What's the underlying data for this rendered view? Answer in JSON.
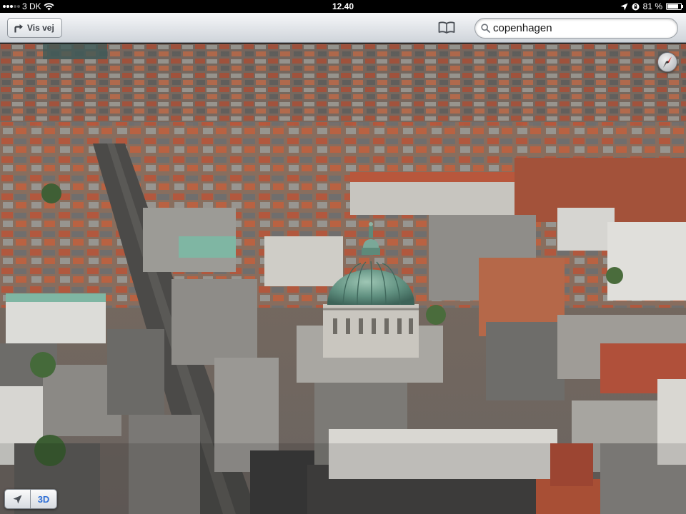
{
  "status_bar": {
    "carrier": "3 DK",
    "time": "12.40",
    "battery_percent": "81 %",
    "battery_level": 0.81
  },
  "toolbar": {
    "directions_label": "Vis vej",
    "directions_icon": "turn-right-arrow-icon",
    "bookmarks_icon": "open-book-icon",
    "search": {
      "value": "copenhagen"
    }
  },
  "map": {
    "mode_3d_label": "3D",
    "compass_icon": "compass-icon",
    "locate_icon": "location-arrow-icon"
  }
}
